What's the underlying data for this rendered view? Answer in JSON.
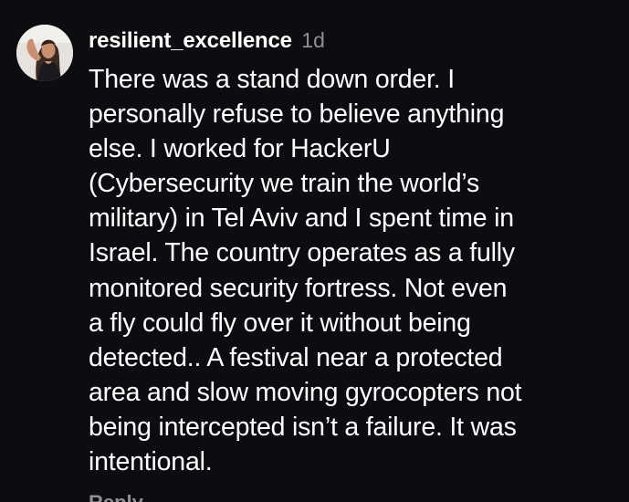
{
  "comment": {
    "username": "resilient_excellence",
    "timestamp": "1d",
    "body_lines": [
      "There was a stand down order. I",
      "personally refuse to believe anything",
      "else. I worked for HackerU",
      "(Cybersecurity we train the world’s",
      "military) in Tel Aviv and I spent time in",
      "Israel. The country operates as a fully",
      "monitored security fortress. Not even",
      "a fly could fly over it without being",
      "detected.. A festival near a protected",
      "area and slow moving gyrocopters not",
      "being intercepted isn’t a failure. It was",
      "intentional."
    ],
    "reply_label": "Reply",
    "avatar_icon": "user-avatar-photo"
  },
  "colors": {
    "background": "#0b0d10",
    "text": "#ffffff",
    "muted": "#8e9096"
  }
}
